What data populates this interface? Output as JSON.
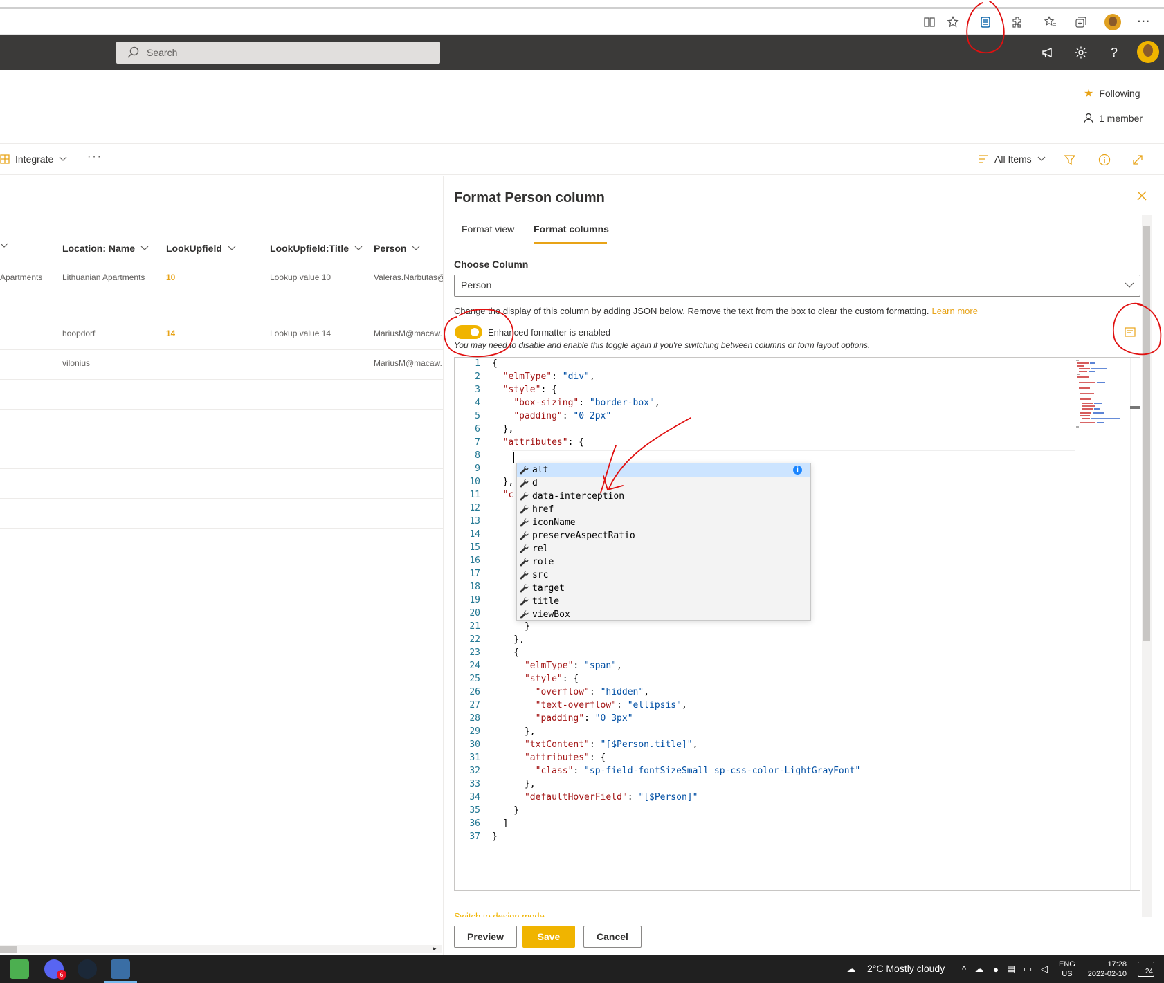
{
  "suite": {
    "search_placeholder": "Search"
  },
  "site": {
    "following": "Following",
    "members": "1 member"
  },
  "commandbar": {
    "integrate": "Integrate",
    "more": "···",
    "view": "All Items"
  },
  "list": {
    "columns": [
      "Location: Name",
      "LookUpfield",
      "LookUpfield:Title",
      "Person"
    ],
    "rows": [
      {
        "partial": "Apartments",
        "location": "Lithuanian Apartments",
        "lookup": "10",
        "lookup_title": "Lookup value 10",
        "person": "Valeras.Narbutas@"
      },
      {
        "partial": "",
        "location": "hoopdorf",
        "lookup": "14",
        "lookup_title": "Lookup value 14",
        "person": "MariusM@macaw."
      },
      {
        "partial": "",
        "location": "vilonius",
        "lookup": "",
        "lookup_title": "",
        "person": "MariusM@macaw."
      }
    ]
  },
  "panel": {
    "title": "Format Person column",
    "tabs": [
      "Format view",
      "Format columns"
    ],
    "active_tab": "Format columns",
    "choose_label": "Choose Column",
    "choose_value": "Person",
    "description": "Change the display of this column by adding JSON below. Remove the text from the box to clear the custom formatting.",
    "learn_more": "Learn more",
    "toggle_label": "Enhanced formatter is enabled",
    "toggle_on": true,
    "toggle_hint": "You may need to disable and enable this toggle again if you're switching between columns or form layout options.",
    "design_mode": "Switch to design mode",
    "buttons": {
      "preview": "Preview",
      "save": "Save",
      "cancel": "Cancel"
    }
  },
  "editor": {
    "line_numbers": [
      "1",
      "2",
      "3",
      "4",
      "5",
      "6",
      "7",
      "8",
      "9",
      "10",
      "11",
      "12",
      "13",
      "14",
      "15",
      "16",
      "17",
      "18",
      "19",
      "20",
      "21",
      "22",
      "23",
      "24",
      "25",
      "26",
      "27",
      "28",
      "29",
      "30",
      "31",
      "32",
      "33",
      "34",
      "35",
      "36",
      "37"
    ],
    "suggestions": [
      "alt",
      "d",
      "data-interception",
      "href",
      "iconName",
      "preserveAspectRatio",
      "rel",
      "role",
      "src",
      "target",
      "title",
      "viewBox"
    ],
    "selected_suggestion": "alt"
  },
  "taskbar": {
    "weather": "2°C  Mostly cloudy",
    "lang_top": "ENG",
    "lang_bottom": "US",
    "time": "17:28",
    "date": "2022-02-10",
    "notifications": "24",
    "badge": "6"
  },
  "colors": {
    "accent": "#f0b400",
    "suitebar": "#3b3a39",
    "taskbar": "#202020",
    "annotation": "#e01010"
  }
}
